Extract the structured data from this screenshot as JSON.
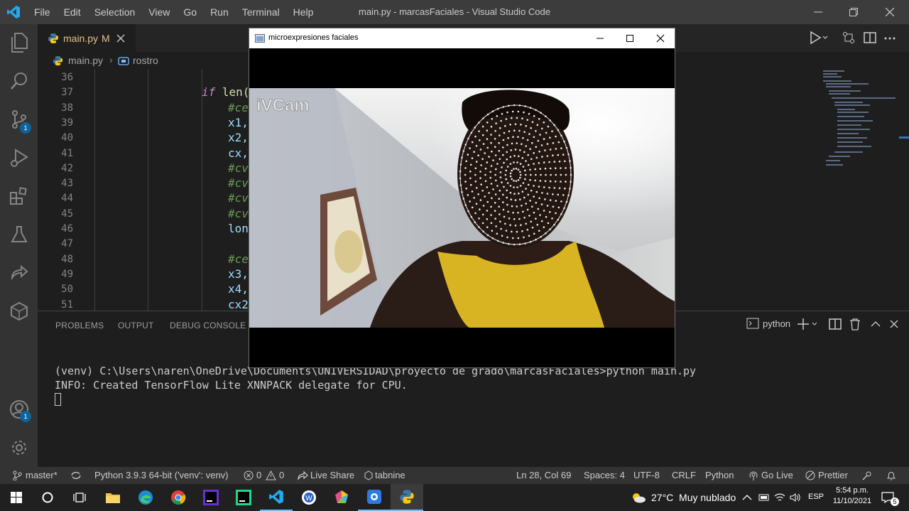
{
  "window": {
    "title": "main.py - marcasFaciales - Visual Studio Code",
    "menu": [
      "File",
      "Edit",
      "Selection",
      "View",
      "Go",
      "Run",
      "Terminal",
      "Help"
    ]
  },
  "activity_bar": {
    "source_control_badge": "1",
    "accounts_badge": "1"
  },
  "tab": {
    "filename": "main.py",
    "modified_marker": "M"
  },
  "breadcrumb": {
    "file": "main.py",
    "symbol": "rostro"
  },
  "editor": {
    "line_numbers": [
      "36",
      "37",
      "38",
      "39",
      "40",
      "41",
      "42",
      "43",
      "44",
      "45",
      "46",
      "47",
      "48",
      "49",
      "50",
      "51"
    ],
    "lines": [
      {
        "kw": "",
        "text": ""
      },
      {
        "kw": "if",
        "text": " len("
      },
      {
        "kw": "",
        "text": "#ce",
        "comment": true
      },
      {
        "kw": "",
        "text": "x1,"
      },
      {
        "kw": "",
        "text": "x2,"
      },
      {
        "kw": "",
        "text": "cx,"
      },
      {
        "kw": "",
        "text": "#cv",
        "comment": true
      },
      {
        "kw": "",
        "text": "#cv",
        "comment": true
      },
      {
        "kw": "",
        "text": "#cv",
        "comment": true
      },
      {
        "kw": "",
        "text": "#cv",
        "comment": true
      },
      {
        "kw": "",
        "text": "lon"
      },
      {
        "kw": "",
        "text": ""
      },
      {
        "kw": "",
        "text": "#ce",
        "comment": true
      },
      {
        "kw": "",
        "text": "x3,"
      },
      {
        "kw": "",
        "text": "x4,"
      },
      {
        "kw": "",
        "text": "cx2"
      }
    ]
  },
  "panel": {
    "tabs": [
      "PROBLEMS",
      "OUTPUT",
      "DEBUG CONSOLE"
    ],
    "terminal_name": "python"
  },
  "terminal": {
    "line1": "(venv) C:\\Users\\naren\\OneDrive\\Documents\\UNIVERSIDAD\\proyecto de grado\\marcasFaciales>python main.py",
    "line2": "INFO: Created TensorFlow Lite XNNPACK delegate for CPU."
  },
  "popup": {
    "title": "microexpresiones faciales",
    "watermark": "iVCam"
  },
  "status_bar": {
    "branch": "master*",
    "interpreter": "Python 3.9.3 64-bit ('venv': venv)",
    "errors": "0",
    "warnings": "0",
    "live_share": "Live Share",
    "tabnine": "tabnine",
    "cursor": "Ln 28, Col 69",
    "spaces": "Spaces: 4",
    "encoding": "UTF-8",
    "eol": "CRLF",
    "language": "Python",
    "go_live": "Go Live",
    "prettier": "Prettier"
  },
  "taskbar": {
    "weather": "27°C  Muy nublado",
    "language": "ESP",
    "time": "5:54 p.m.",
    "date": "11/10/2021",
    "notifications": "5"
  }
}
